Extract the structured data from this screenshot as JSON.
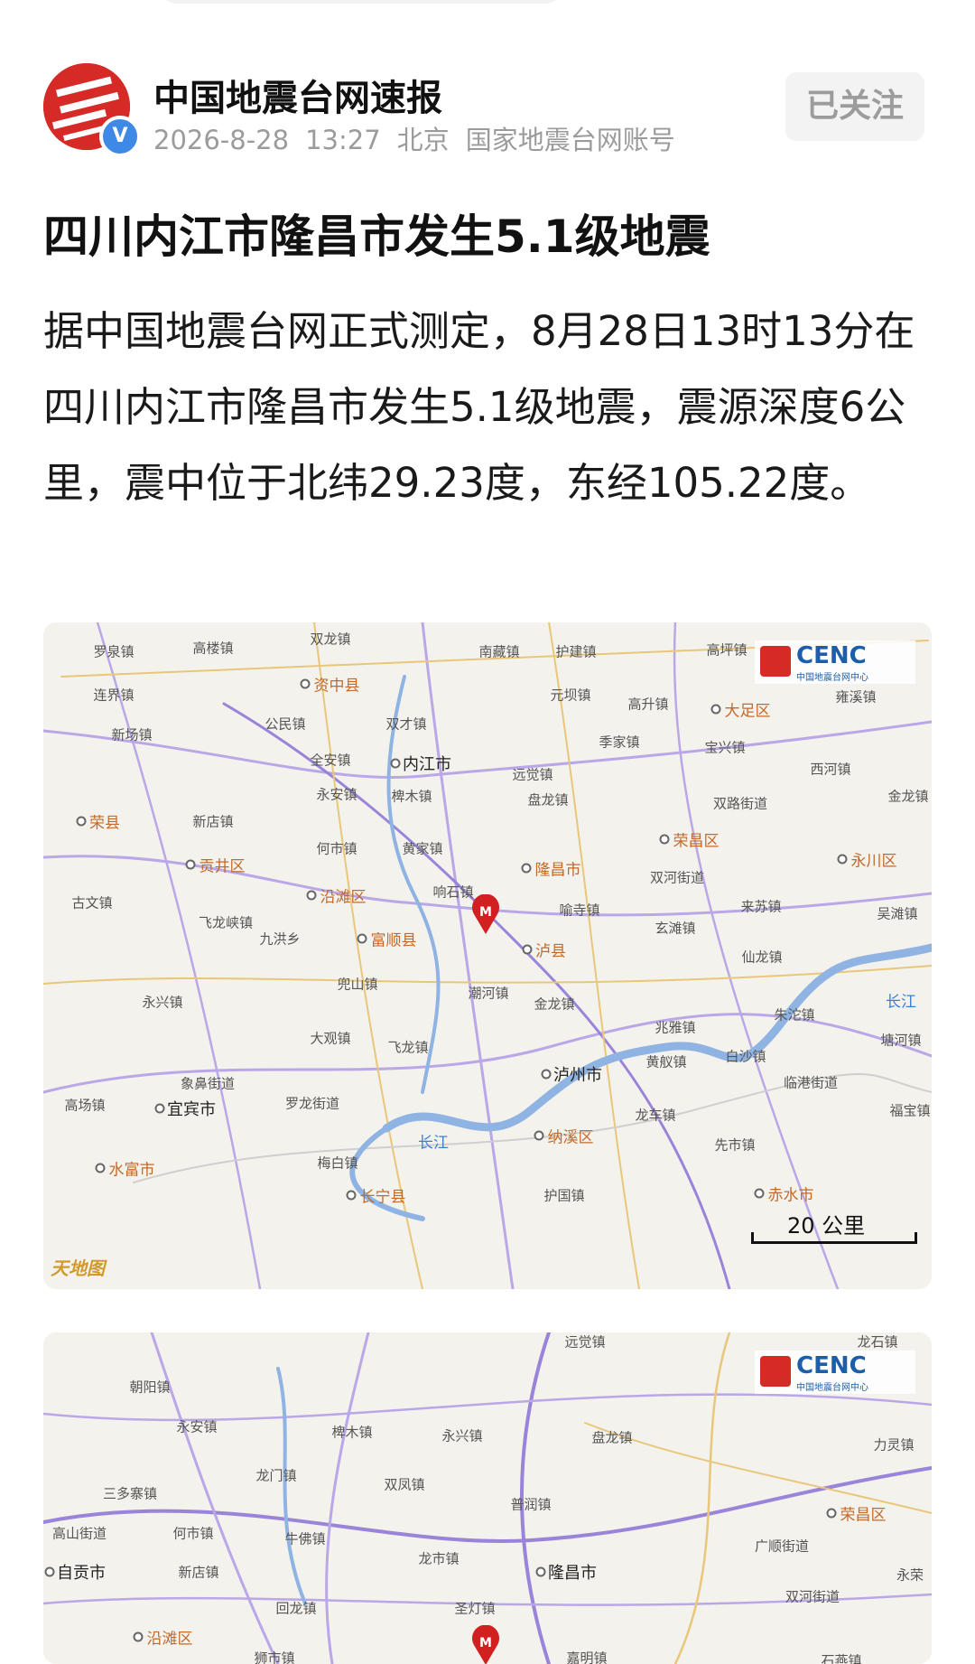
{
  "header": {
    "account_name": "中国地震台网速报",
    "date": "2026-8-28",
    "time": "13:27",
    "location": "北京",
    "account_type": "国家地震台网账号",
    "follow_label": "已关注",
    "verified_badge": "V"
  },
  "article": {
    "title": "四川内江市隆昌市发生5.1级地震",
    "body": "据中国地震台网正式测定，8月28日13时13分在四川内江市隆昌市发生5.1级地震，震源深度6公里，震中位于北纬29.23度，东经105.22度。"
  },
  "map1": {
    "logo_text": "CENC",
    "logo_sub": "中国地震台网中心",
    "scale_label": "20 公里",
    "provider_label": "天地图",
    "labels": [
      {
        "t": "罗泉镇",
        "k": "town"
      },
      {
        "t": "高楼镇",
        "k": "town"
      },
      {
        "t": "双龙镇",
        "k": "town"
      },
      {
        "t": "南藏镇",
        "k": "town"
      },
      {
        "t": "护建镇",
        "k": "town"
      },
      {
        "t": "高坪镇",
        "k": "town"
      },
      {
        "t": "资中县",
        "k": "county"
      },
      {
        "t": "连界镇",
        "k": "town"
      },
      {
        "t": "元坝镇",
        "k": "town"
      },
      {
        "t": "高升镇",
        "k": "town"
      },
      {
        "t": "大足区",
        "k": "county"
      },
      {
        "t": "雍溪镇",
        "k": "town"
      },
      {
        "t": "新场镇",
        "k": "town"
      },
      {
        "t": "公民镇",
        "k": "town"
      },
      {
        "t": "双才镇",
        "k": "town"
      },
      {
        "t": "季家镇",
        "k": "town"
      },
      {
        "t": "宝兴镇",
        "k": "town"
      },
      {
        "t": "全安镇",
        "k": "town"
      },
      {
        "t": "内江市",
        "k": "city"
      },
      {
        "t": "远觉镇",
        "k": "town"
      },
      {
        "t": "西河镇",
        "k": "town"
      },
      {
        "t": "永安镇",
        "k": "town"
      },
      {
        "t": "椑木镇",
        "k": "town"
      },
      {
        "t": "盘龙镇",
        "k": "town"
      },
      {
        "t": "双路街道",
        "k": "town"
      },
      {
        "t": "金龙镇",
        "k": "town"
      },
      {
        "t": "荣县",
        "k": "county"
      },
      {
        "t": "新店镇",
        "k": "town"
      },
      {
        "t": "荣昌区",
        "k": "county"
      },
      {
        "t": "何市镇",
        "k": "town"
      },
      {
        "t": "黄家镇",
        "k": "town"
      },
      {
        "t": "永川区",
        "k": "county"
      },
      {
        "t": "贡井区",
        "k": "county"
      },
      {
        "t": "隆昌市",
        "k": "county"
      },
      {
        "t": "双河街道",
        "k": "town"
      },
      {
        "t": "古文镇",
        "k": "town"
      },
      {
        "t": "沿滩区",
        "k": "county"
      },
      {
        "t": "响石镇",
        "k": "town"
      },
      {
        "t": "来苏镇",
        "k": "town"
      },
      {
        "t": "吴滩镇",
        "k": "town"
      },
      {
        "t": "飞龙峡镇",
        "k": "town"
      },
      {
        "t": "喻寺镇",
        "k": "town"
      },
      {
        "t": "九洪乡",
        "k": "town"
      },
      {
        "t": "富顺县",
        "k": "county"
      },
      {
        "t": "玄滩镇",
        "k": "town"
      },
      {
        "t": "泸县",
        "k": "county"
      },
      {
        "t": "仙龙镇",
        "k": "town"
      },
      {
        "t": "兜山镇",
        "k": "town"
      },
      {
        "t": "潮河镇",
        "k": "town"
      },
      {
        "t": "永兴镇",
        "k": "town"
      },
      {
        "t": "金龙镇",
        "k": "town"
      },
      {
        "t": "朱沱镇",
        "k": "town"
      },
      {
        "t": "长江",
        "k": "river"
      },
      {
        "t": "大观镇",
        "k": "town"
      },
      {
        "t": "飞龙镇",
        "k": "town"
      },
      {
        "t": "兆雅镇",
        "k": "town"
      },
      {
        "t": "塘河镇",
        "k": "town"
      },
      {
        "t": "白沙镇",
        "k": "town"
      },
      {
        "t": "黄舣镇",
        "k": "town"
      },
      {
        "t": "象鼻街道",
        "k": "town"
      },
      {
        "t": "泸州市",
        "k": "city"
      },
      {
        "t": "临港街道",
        "k": "town"
      },
      {
        "t": "高场镇",
        "k": "town"
      },
      {
        "t": "宜宾市",
        "k": "city"
      },
      {
        "t": "罗龙街道",
        "k": "town"
      },
      {
        "t": "龙车镇",
        "k": "town"
      },
      {
        "t": "福宝镇",
        "k": "town"
      },
      {
        "t": "长江",
        "k": "river"
      },
      {
        "t": "先市镇",
        "k": "town"
      },
      {
        "t": "纳溪区",
        "k": "county"
      },
      {
        "t": "梅白镇",
        "k": "town"
      },
      {
        "t": "水富市",
        "k": "county"
      },
      {
        "t": "长宁县",
        "k": "county"
      },
      {
        "t": "护国镇",
        "k": "town"
      },
      {
        "t": "赤水市",
        "k": "county"
      }
    ]
  },
  "map2": {
    "logo_text": "CENC",
    "logo_sub": "中国地震台网中心",
    "labels": [
      {
        "t": "远觉镇",
        "k": "town"
      },
      {
        "t": "龙石镇",
        "k": "town"
      },
      {
        "t": "朝阳镇",
        "k": "town"
      },
      {
        "t": "永安镇",
        "k": "town"
      },
      {
        "t": "椑木镇",
        "k": "town"
      },
      {
        "t": "永兴镇",
        "k": "town"
      },
      {
        "t": "盘龙镇",
        "k": "town"
      },
      {
        "t": "力灵镇",
        "k": "town"
      },
      {
        "t": "龙门镇",
        "k": "town"
      },
      {
        "t": "双凤镇",
        "k": "town"
      },
      {
        "t": "三多寨镇",
        "k": "town"
      },
      {
        "t": "普润镇",
        "k": "town"
      },
      {
        "t": "荣昌区",
        "k": "county"
      },
      {
        "t": "高山街道",
        "k": "town"
      },
      {
        "t": "何市镇",
        "k": "town"
      },
      {
        "t": "牛佛镇",
        "k": "town"
      },
      {
        "t": "广顺街道",
        "k": "town"
      },
      {
        "t": "自贡市",
        "k": "city"
      },
      {
        "t": "新店镇",
        "k": "town"
      },
      {
        "t": "龙市镇",
        "k": "town"
      },
      {
        "t": "隆昌市",
        "k": "city"
      },
      {
        "t": "永荣",
        "k": "town"
      },
      {
        "t": "回龙镇",
        "k": "town"
      },
      {
        "t": "双河街道",
        "k": "town"
      },
      {
        "t": "沿滩区",
        "k": "county"
      },
      {
        "t": "圣灯镇",
        "k": "town"
      },
      {
        "t": "狮市镇",
        "k": "town"
      },
      {
        "t": "嘉明镇",
        "k": "town"
      },
      {
        "t": "石燕镇",
        "k": "town"
      }
    ]
  }
}
